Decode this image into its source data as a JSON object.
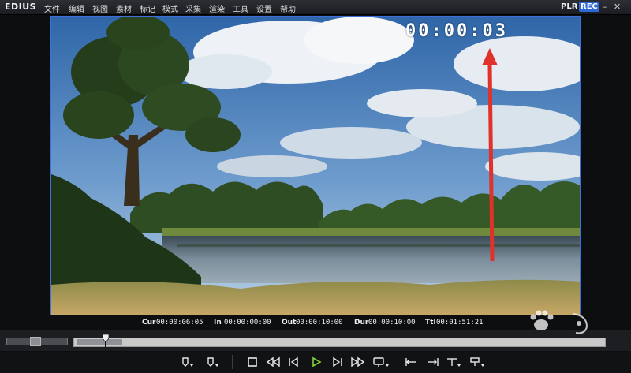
{
  "app": {
    "logo": "EDIUS",
    "menu": [
      "文件",
      "编辑",
      "视图",
      "素材",
      "标记",
      "模式",
      "采集",
      "渲染",
      "工具",
      "设置",
      "帮助"
    ],
    "mode_plr": "PLR",
    "mode_rec": "REC"
  },
  "viewer": {
    "timecode_overlay": "00:00:03"
  },
  "status": {
    "cur_label": "Cur",
    "cur_value": "00:00:06:05",
    "in_label": "In",
    "in_value": "00:00:00:00",
    "out_label": "Out",
    "out_value": "00:00:10:00",
    "dur_label": "Dur",
    "dur_value": "00:00:10:00",
    "ttl_label": "Ttl",
    "ttl_value": "00:01:51:21"
  },
  "timeline": {
    "playhead_fraction": 0.06
  },
  "transport": {
    "buttons": [
      "set-in",
      "set-out",
      "stop",
      "rewind",
      "step-back",
      "play",
      "step-forward",
      "fast-forward",
      "loop",
      "mark-in",
      "mark-out",
      "trim",
      "overwrite"
    ]
  },
  "colors": {
    "accent_rec": "#2e68d6",
    "viewer_border": "#3f6fd8",
    "arrow": "#e0312b",
    "play_icon": "#7fd23a"
  }
}
